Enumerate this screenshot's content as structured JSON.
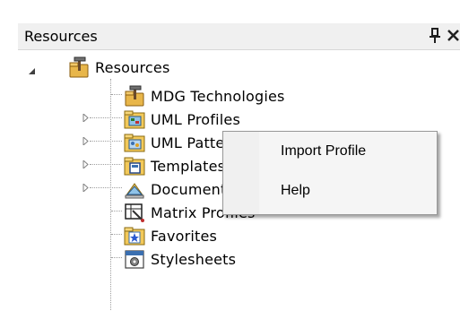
{
  "panel": {
    "title": "Resources"
  },
  "tree": {
    "root": {
      "label": "Resources",
      "icon": "resources-hammer-icon"
    },
    "items": [
      {
        "label": "MDG Technologies",
        "icon": "mdg-hammer-icon"
      },
      {
        "label": "UML Profiles",
        "icon": "uml-profiles-folder-icon"
      },
      {
        "label": "UML Patterns",
        "icon": "uml-patterns-folder-icon"
      },
      {
        "label": "Templates",
        "icon": "templates-folder-icon"
      },
      {
        "label": "Documents",
        "icon": "documents-icon"
      },
      {
        "label": "Matrix Profiles",
        "icon": "matrix-profiles-icon"
      },
      {
        "label": "Favorites",
        "icon": "favorites-star-folder-icon"
      },
      {
        "label": "Stylesheets",
        "icon": "stylesheets-icon"
      }
    ]
  },
  "context_menu": {
    "items": [
      {
        "label": "Import Profile"
      },
      {
        "label": "Help"
      }
    ]
  }
}
